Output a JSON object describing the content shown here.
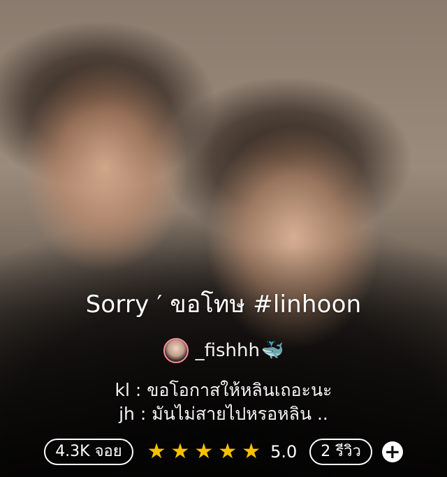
{
  "story": {
    "title": "Sorry ′ ขอโทษ #linhoon",
    "author": "_fishhh",
    "author_emoji": "🐳",
    "description_lines": [
      "kl : ขอโอกาสให้หลินเถอะนะ",
      "jh : มันไม่สายไปหรอหลิน .."
    ]
  },
  "stats": {
    "reads": "4.3K จอย",
    "stars_filled": 5,
    "rating": "5.0",
    "reviews": "2 รีวิว",
    "star_icon": "star-icon",
    "add_icon": "plus-icon"
  },
  "colors": {
    "star": "#f6c100",
    "avatar_border": "#ff8aa0",
    "text": "#ffffff"
  }
}
